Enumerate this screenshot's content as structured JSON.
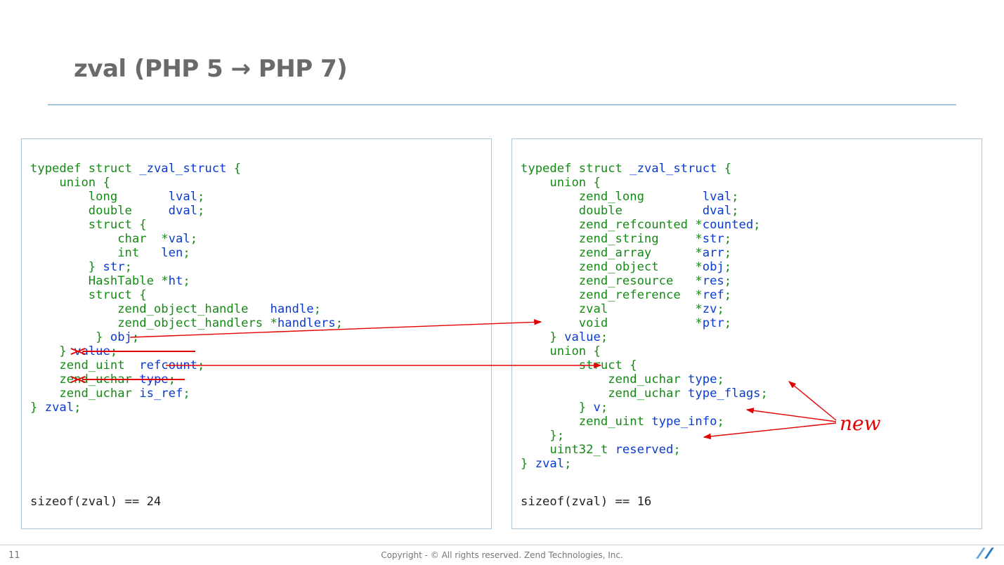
{
  "title": "zval (PHP 5 → PHP 7)",
  "page_number": "11",
  "copyright": "Copyright - © All rights reserved. Zend Technologies, Inc.",
  "new_label": "new",
  "left": {
    "sizeof": "sizeof(zval) == 24",
    "tokens": {
      "typedef": "typedef",
      "struct": "struct",
      "zval_struct": "_zval_struct",
      "union": "union",
      "long": "long",
      "lval": "lval",
      "double": "double",
      "dval": "dval",
      "char": "char",
      "val": "val",
      "int": "int",
      "len": "len",
      "str": "str",
      "HashTable": "HashTable",
      "ht": "ht",
      "zoh": "zend_object_handle",
      "handle": "handle",
      "zohs": "zend_object_handlers",
      "handlers": "handlers",
      "obj": "obj",
      "value": "value",
      "zend_uint": "zend_uint",
      "refcount": "refcount",
      "zend_uchar": "zend_uchar",
      "type": "type",
      "is_ref": "is_ref",
      "zval": "zval"
    }
  },
  "right": {
    "sizeof": "sizeof(zval) == 16",
    "tokens": {
      "typedef": "typedef",
      "struct": "struct",
      "zval_struct": "_zval_struct",
      "union": "union",
      "zend_long": "zend_long",
      "lval": "lval",
      "double": "double",
      "dval": "dval",
      "zend_refcounted": "zend_refcounted",
      "counted": "counted",
      "zend_string": "zend_string",
      "str": "str",
      "zend_array": "zend_array",
      "arr": "arr",
      "zend_object": "zend_object",
      "obj": "obj",
      "zend_resource": "zend_resource",
      "res": "res",
      "zend_reference": "zend_reference",
      "ref": "ref",
      "zval_t": "zval",
      "zv": "zv",
      "void": "void",
      "ptr": "ptr",
      "value": "value",
      "zend_uchar": "zend_uchar",
      "type": "type",
      "type_flags": "type_flags",
      "v": "v",
      "zend_uint": "zend_uint",
      "type_info": "type_info",
      "uint32_t": "uint32_t",
      "reserved": "reserved",
      "zval": "zval"
    }
  }
}
